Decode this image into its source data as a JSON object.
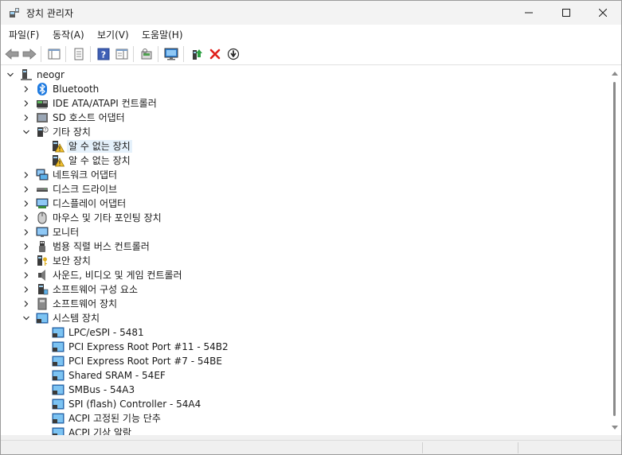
{
  "window": {
    "title": "장치 관리자",
    "controls": {
      "minimize": "minimize",
      "maximize": "maximize",
      "close": "close"
    }
  },
  "menu": [
    "파일(F)",
    "동작(A)",
    "보기(V)",
    "도움말(H)"
  ],
  "toolbar": [
    {
      "name": "back-icon"
    },
    {
      "name": "forward-icon"
    },
    {
      "name": "show-hide-console-tree-icon"
    },
    {
      "name": "properties-icon"
    },
    {
      "name": "help-icon"
    },
    {
      "name": "show-action-pane-icon"
    },
    {
      "name": "scan-hardware-icon"
    },
    {
      "name": "monitor-icon"
    },
    {
      "name": "update-driver-icon"
    },
    {
      "name": "uninstall-device-icon"
    },
    {
      "name": "disable-device-icon"
    }
  ],
  "tree": [
    {
      "level": 0,
      "chev": "down",
      "icon": "computer-icon",
      "label": "neogr"
    },
    {
      "level": 1,
      "chev": "right",
      "icon": "bluetooth-icon",
      "label": "Bluetooth"
    },
    {
      "level": 1,
      "chev": "right",
      "icon": "ide-controller-icon",
      "label": "IDE ATA/ATAPI 컨트롤러"
    },
    {
      "level": 1,
      "chev": "right",
      "icon": "sd-host-icon",
      "label": "SD 호스트 어댑터"
    },
    {
      "level": 1,
      "chev": "down",
      "icon": "other-devices-icon",
      "label": "기타 장치"
    },
    {
      "level": 2,
      "chev": "none",
      "icon": "warning-device-icon",
      "label": "알 수 없는 장치",
      "selected": true
    },
    {
      "level": 2,
      "chev": "none",
      "icon": "warning-device-icon",
      "label": "알 수 없는 장치"
    },
    {
      "level": 1,
      "chev": "right",
      "icon": "network-adapter-icon",
      "label": "네트워크 어댑터"
    },
    {
      "level": 1,
      "chev": "right",
      "icon": "disk-drive-icon",
      "label": "디스크 드라이브"
    },
    {
      "level": 1,
      "chev": "right",
      "icon": "display-adapter-icon",
      "label": "디스플레이 어댑터"
    },
    {
      "level": 1,
      "chev": "right",
      "icon": "mouse-icon",
      "label": "마우스 및 기타 포인팅 장치"
    },
    {
      "level": 1,
      "chev": "right",
      "icon": "monitor-icon",
      "label": "모니터"
    },
    {
      "level": 1,
      "chev": "right",
      "icon": "usb-icon",
      "label": "범용 직렬 버스 컨트롤러"
    },
    {
      "level": 1,
      "chev": "right",
      "icon": "security-device-icon",
      "label": "보안 장치"
    },
    {
      "level": 1,
      "chev": "right",
      "icon": "sound-icon",
      "label": "사운드, 비디오 및 게임 컨트롤러"
    },
    {
      "level": 1,
      "chev": "right",
      "icon": "software-component-icon",
      "label": "소프트웨어 구성 요소"
    },
    {
      "level": 1,
      "chev": "right",
      "icon": "software-device-icon",
      "label": "소프트웨어 장치"
    },
    {
      "level": 1,
      "chev": "down",
      "icon": "system-device-icon",
      "label": "시스템 장치"
    },
    {
      "level": 2,
      "chev": "none",
      "icon": "system-device-icon",
      "label": "LPC/eSPI - 5481"
    },
    {
      "level": 2,
      "chev": "none",
      "icon": "system-device-icon",
      "label": "PCI Express Root Port #11 - 54B2"
    },
    {
      "level": 2,
      "chev": "none",
      "icon": "system-device-icon",
      "label": "PCI Express Root Port #7 - 54BE"
    },
    {
      "level": 2,
      "chev": "none",
      "icon": "system-device-icon",
      "label": "Shared SRAM - 54EF"
    },
    {
      "level": 2,
      "chev": "none",
      "icon": "system-device-icon",
      "label": "SMBus - 54A3"
    },
    {
      "level": 2,
      "chev": "none",
      "icon": "system-device-icon",
      "label": "SPI (flash) Controller - 54A4"
    },
    {
      "level": 2,
      "chev": "none",
      "icon": "system-device-icon",
      "label": "ACPI 고정된 기능 단추"
    },
    {
      "level": 2,
      "chev": "none",
      "icon": "system-device-icon",
      "label": "ACPI 기상 알람"
    }
  ]
}
